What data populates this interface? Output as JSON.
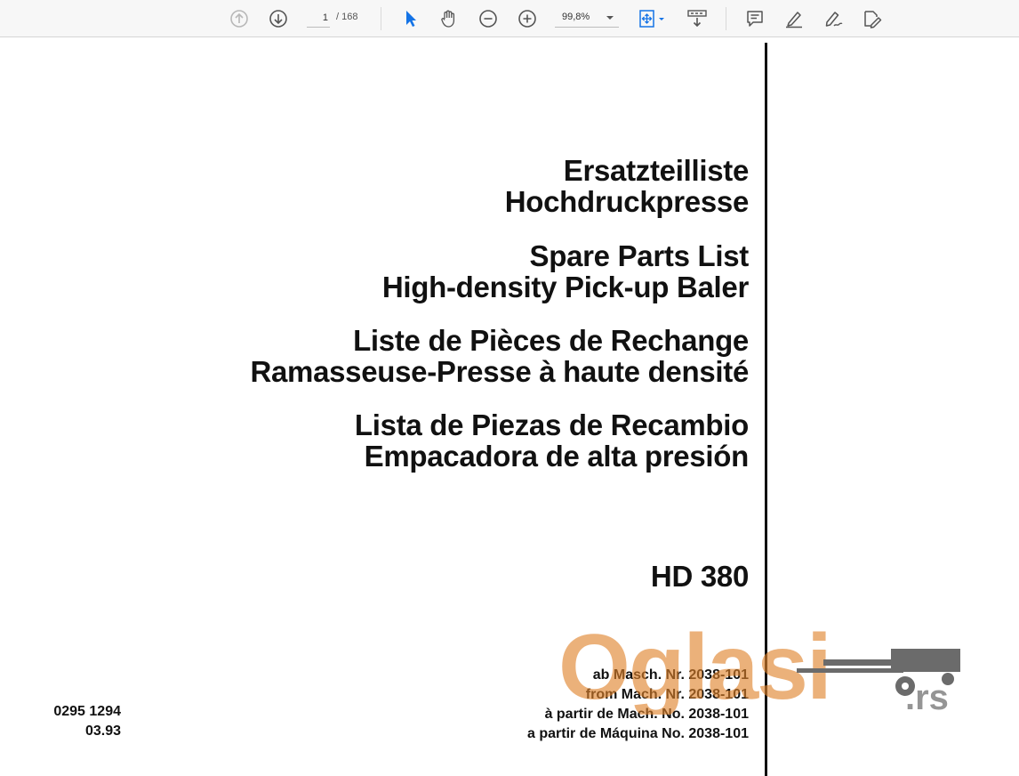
{
  "toolbar": {
    "page_current": "1",
    "page_total": "/ 168",
    "zoom": "99,8%",
    "icons": [
      "prev-page-icon",
      "next-page-icon",
      "select-cursor-icon",
      "hand-tool-icon",
      "zoom-out-icon",
      "zoom-in-icon",
      "fit-page-icon",
      "scroll-mode-icon",
      "comment-icon",
      "highlight-icon",
      "draw-icon",
      "fill-sign-icon"
    ],
    "accent_color": "#1473e6"
  },
  "document": {
    "title_de_1": "Ersatzteilliste",
    "title_de_2": "Hochdruckpresse",
    "title_en_1": "Spare Parts List",
    "title_en_2": "High-density Pick-up Baler",
    "title_fr_1": "Liste de Pièces de Rechange",
    "title_fr_2": "Ramasseuse-Presse à haute densité",
    "title_es_1": "Lista de Piezas de Recambio",
    "title_es_2": "Empacadora de alta presión",
    "model": "HD 380",
    "mach_de": "ab Masch. Nr. 2038-101",
    "mach_en": "from Mach. Nr. 2038-101",
    "mach_fr": "à partir de Mach. No. 2038-101",
    "mach_es": "a partir de Máquina No. 2038-101",
    "doc_number": "0295 1294",
    "doc_date": "03.93"
  },
  "watermark": {
    "text": "Oglasi",
    "suffix": ".rs",
    "color": "#e0822a"
  }
}
